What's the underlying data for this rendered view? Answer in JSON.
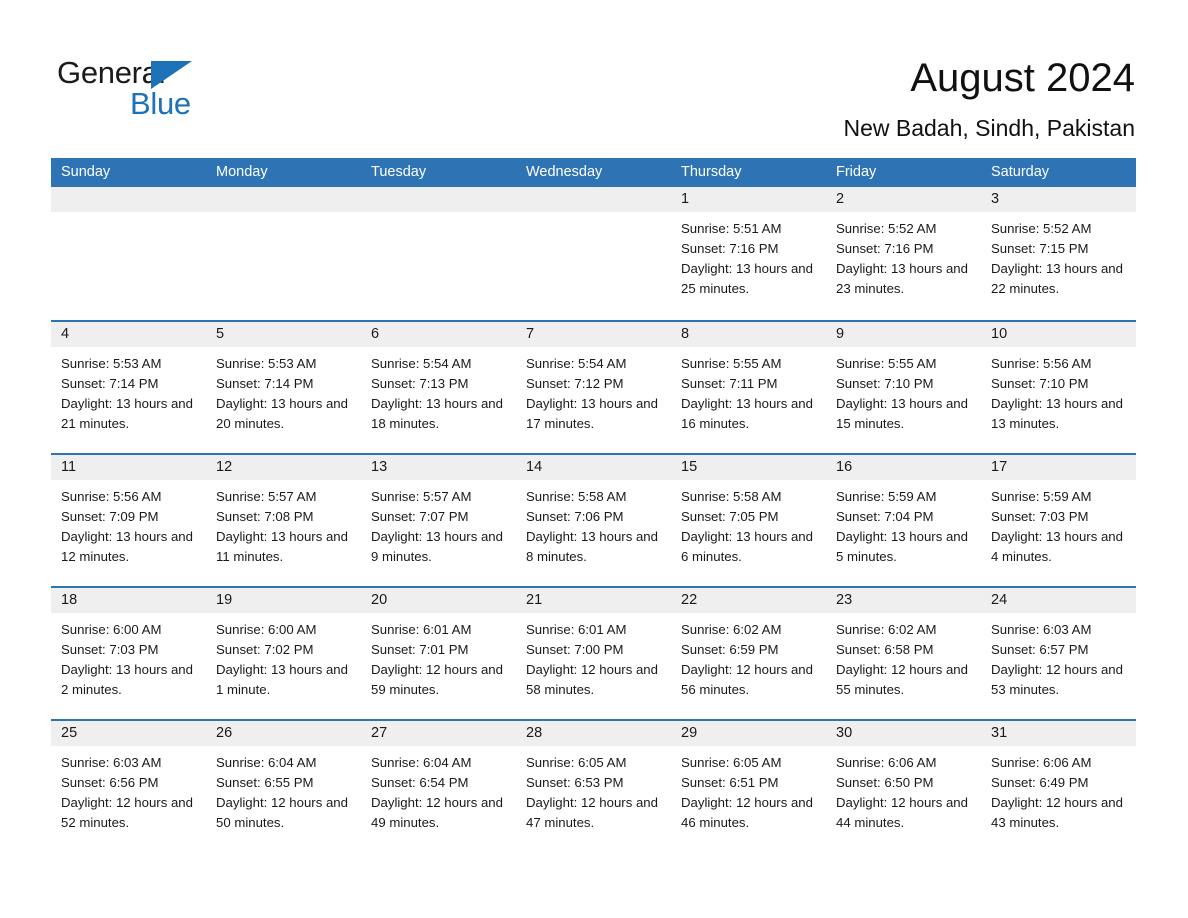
{
  "brand": {
    "name_part1": "General",
    "name_part2": "Blue",
    "triangle_icon": "brand-triangle-icon",
    "accent_color": "#1b72b8"
  },
  "header": {
    "month_title": "August 2024",
    "location": "New Badah, Sindh, Pakistan"
  },
  "calendar": {
    "header_bg": "#2e74b5",
    "daynum_bg": "#efefef",
    "weekdays": [
      "Sunday",
      "Monday",
      "Tuesday",
      "Wednesday",
      "Thursday",
      "Friday",
      "Saturday"
    ],
    "weeks": [
      [
        {
          "day": "",
          "sunrise": "",
          "sunset": "",
          "daylight": "",
          "empty": true
        },
        {
          "day": "",
          "sunrise": "",
          "sunset": "",
          "daylight": "",
          "empty": true
        },
        {
          "day": "",
          "sunrise": "",
          "sunset": "",
          "daylight": "",
          "empty": true
        },
        {
          "day": "",
          "sunrise": "",
          "sunset": "",
          "daylight": "",
          "empty": true
        },
        {
          "day": "1",
          "sunrise": "Sunrise: 5:51 AM",
          "sunset": "Sunset: 7:16 PM",
          "daylight": "Daylight: 13 hours and 25 minutes."
        },
        {
          "day": "2",
          "sunrise": "Sunrise: 5:52 AM",
          "sunset": "Sunset: 7:16 PM",
          "daylight": "Daylight: 13 hours and 23 minutes."
        },
        {
          "day": "3",
          "sunrise": "Sunrise: 5:52 AM",
          "sunset": "Sunset: 7:15 PM",
          "daylight": "Daylight: 13 hours and 22 minutes."
        }
      ],
      [
        {
          "day": "4",
          "sunrise": "Sunrise: 5:53 AM",
          "sunset": "Sunset: 7:14 PM",
          "daylight": "Daylight: 13 hours and 21 minutes."
        },
        {
          "day": "5",
          "sunrise": "Sunrise: 5:53 AM",
          "sunset": "Sunset: 7:14 PM",
          "daylight": "Daylight: 13 hours and 20 minutes."
        },
        {
          "day": "6",
          "sunrise": "Sunrise: 5:54 AM",
          "sunset": "Sunset: 7:13 PM",
          "daylight": "Daylight: 13 hours and 18 minutes."
        },
        {
          "day": "7",
          "sunrise": "Sunrise: 5:54 AM",
          "sunset": "Sunset: 7:12 PM",
          "daylight": "Daylight: 13 hours and 17 minutes."
        },
        {
          "day": "8",
          "sunrise": "Sunrise: 5:55 AM",
          "sunset": "Sunset: 7:11 PM",
          "daylight": "Daylight: 13 hours and 16 minutes."
        },
        {
          "day": "9",
          "sunrise": "Sunrise: 5:55 AM",
          "sunset": "Sunset: 7:10 PM",
          "daylight": "Daylight: 13 hours and 15 minutes."
        },
        {
          "day": "10",
          "sunrise": "Sunrise: 5:56 AM",
          "sunset": "Sunset: 7:10 PM",
          "daylight": "Daylight: 13 hours and 13 minutes."
        }
      ],
      [
        {
          "day": "11",
          "sunrise": "Sunrise: 5:56 AM",
          "sunset": "Sunset: 7:09 PM",
          "daylight": "Daylight: 13 hours and 12 minutes."
        },
        {
          "day": "12",
          "sunrise": "Sunrise: 5:57 AM",
          "sunset": "Sunset: 7:08 PM",
          "daylight": "Daylight: 13 hours and 11 minutes."
        },
        {
          "day": "13",
          "sunrise": "Sunrise: 5:57 AM",
          "sunset": "Sunset: 7:07 PM",
          "daylight": "Daylight: 13 hours and 9 minutes."
        },
        {
          "day": "14",
          "sunrise": "Sunrise: 5:58 AM",
          "sunset": "Sunset: 7:06 PM",
          "daylight": "Daylight: 13 hours and 8 minutes."
        },
        {
          "day": "15",
          "sunrise": "Sunrise: 5:58 AM",
          "sunset": "Sunset: 7:05 PM",
          "daylight": "Daylight: 13 hours and 6 minutes."
        },
        {
          "day": "16",
          "sunrise": "Sunrise: 5:59 AM",
          "sunset": "Sunset: 7:04 PM",
          "daylight": "Daylight: 13 hours and 5 minutes."
        },
        {
          "day": "17",
          "sunrise": "Sunrise: 5:59 AM",
          "sunset": "Sunset: 7:03 PM",
          "daylight": "Daylight: 13 hours and 4 minutes."
        }
      ],
      [
        {
          "day": "18",
          "sunrise": "Sunrise: 6:00 AM",
          "sunset": "Sunset: 7:03 PM",
          "daylight": "Daylight: 13 hours and 2 minutes."
        },
        {
          "day": "19",
          "sunrise": "Sunrise: 6:00 AM",
          "sunset": "Sunset: 7:02 PM",
          "daylight": "Daylight: 13 hours and 1 minute."
        },
        {
          "day": "20",
          "sunrise": "Sunrise: 6:01 AM",
          "sunset": "Sunset: 7:01 PM",
          "daylight": "Daylight: 12 hours and 59 minutes."
        },
        {
          "day": "21",
          "sunrise": "Sunrise: 6:01 AM",
          "sunset": "Sunset: 7:00 PM",
          "daylight": "Daylight: 12 hours and 58 minutes."
        },
        {
          "day": "22",
          "sunrise": "Sunrise: 6:02 AM",
          "sunset": "Sunset: 6:59 PM",
          "daylight": "Daylight: 12 hours and 56 minutes."
        },
        {
          "day": "23",
          "sunrise": "Sunrise: 6:02 AM",
          "sunset": "Sunset: 6:58 PM",
          "daylight": "Daylight: 12 hours and 55 minutes."
        },
        {
          "day": "24",
          "sunrise": "Sunrise: 6:03 AM",
          "sunset": "Sunset: 6:57 PM",
          "daylight": "Daylight: 12 hours and 53 minutes."
        }
      ],
      [
        {
          "day": "25",
          "sunrise": "Sunrise: 6:03 AM",
          "sunset": "Sunset: 6:56 PM",
          "daylight": "Daylight: 12 hours and 52 minutes."
        },
        {
          "day": "26",
          "sunrise": "Sunrise: 6:04 AM",
          "sunset": "Sunset: 6:55 PM",
          "daylight": "Daylight: 12 hours and 50 minutes."
        },
        {
          "day": "27",
          "sunrise": "Sunrise: 6:04 AM",
          "sunset": "Sunset: 6:54 PM",
          "daylight": "Daylight: 12 hours and 49 minutes."
        },
        {
          "day": "28",
          "sunrise": "Sunrise: 6:05 AM",
          "sunset": "Sunset: 6:53 PM",
          "daylight": "Daylight: 12 hours and 47 minutes."
        },
        {
          "day": "29",
          "sunrise": "Sunrise: 6:05 AM",
          "sunset": "Sunset: 6:51 PM",
          "daylight": "Daylight: 12 hours and 46 minutes."
        },
        {
          "day": "30",
          "sunrise": "Sunrise: 6:06 AM",
          "sunset": "Sunset: 6:50 PM",
          "daylight": "Daylight: 12 hours and 44 minutes."
        },
        {
          "day": "31",
          "sunrise": "Sunrise: 6:06 AM",
          "sunset": "Sunset: 6:49 PM",
          "daylight": "Daylight: 12 hours and 43 minutes."
        }
      ]
    ]
  }
}
